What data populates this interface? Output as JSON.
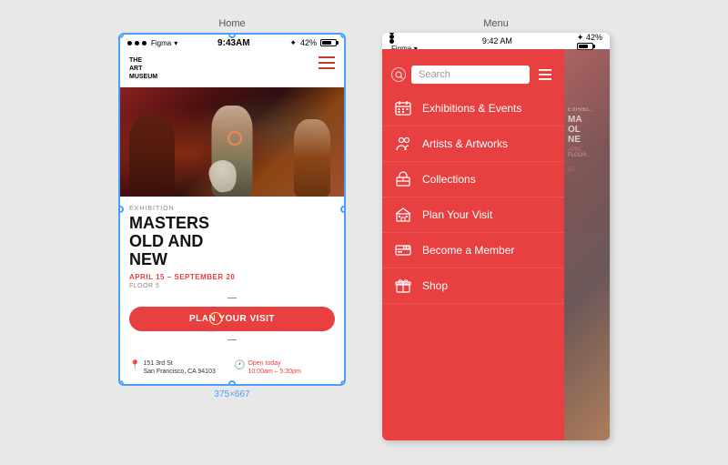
{
  "home_frame": {
    "label": "Home",
    "size_label": "375×667",
    "status_bar": {
      "dots": "●●●",
      "carrier": "Figma",
      "signal": "▾",
      "time": "9:43AM",
      "bluetooth": "✦",
      "battery_pct": "42%"
    },
    "nav": {
      "logo_line1": "THE",
      "logo_line2": "ART",
      "logo_line3": "MUSEUM"
    },
    "exhibition": {
      "label": "EXHIBITION",
      "title_line1": "MASTERS",
      "title_line2": "OLD AND",
      "title_line3": "NEW",
      "dates": "APRIL 15 – SEPTEMBER 20",
      "floor": "FLOOR 5",
      "cta_label": "Plan Your Visit"
    },
    "footer": {
      "address": "151 3rd St\nSan Francisco, CA 94103",
      "hours_label": "Open today",
      "hours": "10:00am – 5:30pm"
    }
  },
  "menu_frame": {
    "label": "Menu",
    "status_bar": {
      "dots": "●●●",
      "carrier": "Figma",
      "signal": "▾",
      "time": "9:42 AM",
      "bluetooth": "✦",
      "battery_pct": "42%"
    },
    "search": {
      "placeholder": "Search"
    },
    "items": [
      {
        "id": "exhibitions",
        "label": "Exhibitions & Events",
        "icon": "calendar-icon"
      },
      {
        "id": "artists",
        "label": "Artists & Artworks",
        "icon": "person-icon"
      },
      {
        "id": "collections",
        "label": "Collections",
        "icon": "box-icon"
      },
      {
        "id": "visit",
        "label": "Plan Your Visit",
        "icon": "building-icon"
      },
      {
        "id": "member",
        "label": "Become a Member",
        "icon": "card-icon"
      },
      {
        "id": "shop",
        "label": "Shop",
        "icon": "gift-icon"
      }
    ],
    "peek": {
      "exhibition_label": "EXHIBI...",
      "title": "MA\nOL\nNE",
      "dates": "APRI...",
      "floor": "FLOOR...",
      "address": "15..."
    }
  },
  "accent_color": "#e84040",
  "frame_color": "#4a9eff"
}
